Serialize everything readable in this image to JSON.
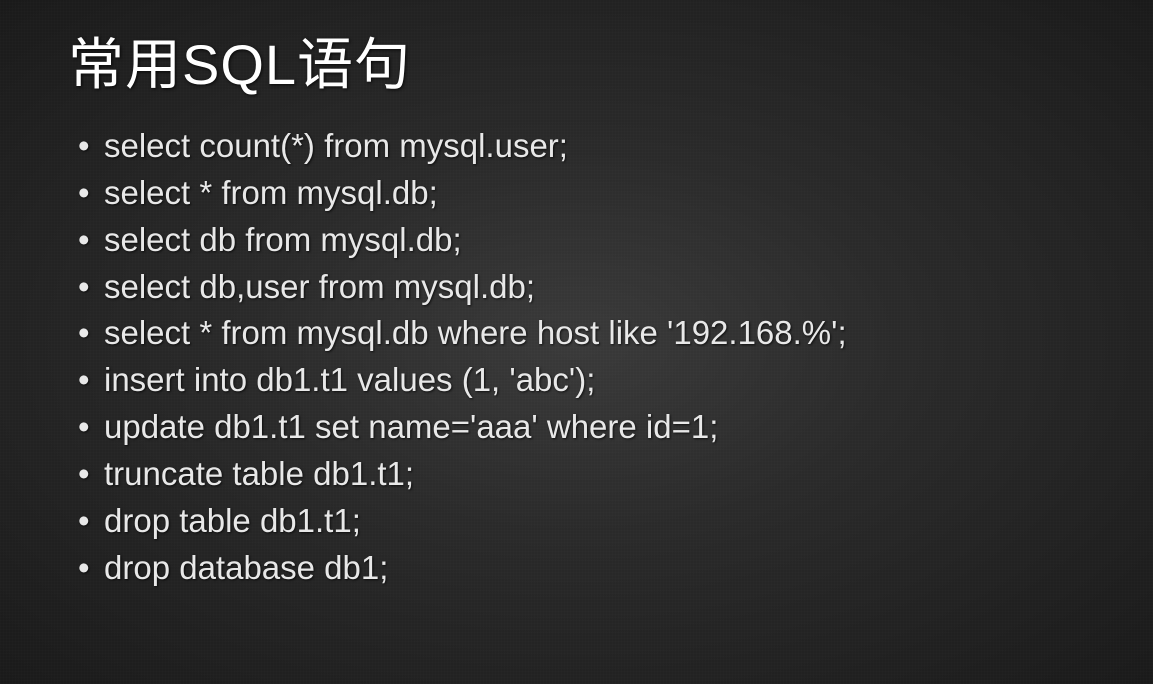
{
  "slide": {
    "title": "常用SQL语句",
    "bullets": [
      "select count(*) from mysql.user;",
      "select * from mysql.db;",
      "select db from mysql.db;",
      "select db,user from mysql.db;",
      "select * from mysql.db where host like '192.168.%';",
      "insert into db1.t1 values (1, 'abc');",
      "update db1.t1 set name='aaa' where id=1;",
      "truncate table db1.t1;",
      "drop table db1.t1;",
      "drop database db1;"
    ]
  }
}
